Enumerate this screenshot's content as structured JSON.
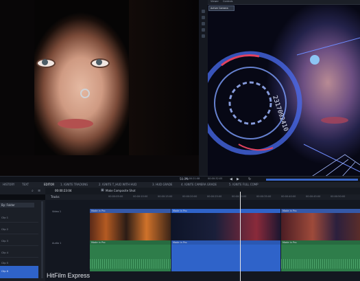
{
  "viewer_right": {
    "active_camera": "Active Camera",
    "panel_tab_1": "Viewer",
    "panel_tab_2": "Controls"
  },
  "hud_text": "2317092410",
  "status": {
    "zoom": "50.0%",
    "timecode_left": "00:00:21:08",
    "timecode_right": "00:00:32:05"
  },
  "tabs": [
    {
      "label": "HISTORY"
    },
    {
      "label": "TEXT"
    },
    {
      "label": "EDITOR"
    },
    {
      "label": "1. IGNITE TRACKING"
    },
    {
      "label": "2. IGNITE T_HUD WITH HUD"
    },
    {
      "label": "3. HUD GRADE"
    },
    {
      "label": "4. IGNITE CAMERA GRADE"
    },
    {
      "label": "5. IGNITE FULL COMP"
    }
  ],
  "toolbar": {
    "timecode": "00:00:23:04",
    "make_composite": "Make Composite Shot"
  },
  "timeline": {
    "header": "Tracks",
    "ruler_ticks": [
      "00:00:05:00",
      "00:00:10:00",
      "00:00:15:00",
      "00:00:20:00",
      "00:00:25:00",
      "00:00:30:00",
      "00:00:35:00",
      "00:00:40:00",
      "00:00:45:00",
      "00:00:50:00"
    ],
    "video_track_label": "Video 1",
    "audio_track_label": "Audio 1",
    "video_clips": [
      "Made in Pro",
      "Made in Pro",
      "Made in Pro"
    ],
    "audio_clips": [
      "Made in Pro",
      "Made in Pro",
      "Made in Pro"
    ]
  },
  "left_panel": {
    "sort_label": "By: Folder",
    "rows": [
      "Clip 1",
      "Clip 2",
      "Clip 3",
      "Clip 4",
      "Clip 5",
      "Clip 6"
    ]
  },
  "watermark": "HitFilm Express",
  "colors": {
    "video_clip": "#3559a8",
    "audio_clip": "#2e7d4a",
    "selected_clip": "#2f63c9",
    "accent": "#5a8cff"
  }
}
